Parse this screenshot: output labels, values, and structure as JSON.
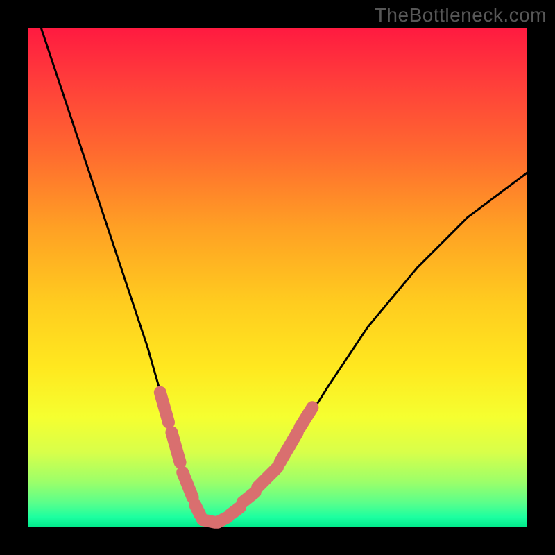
{
  "watermark": "TheBottleneck.com",
  "colors": {
    "frame": "#000000",
    "gradient_top": "#ff1a40",
    "gradient_bottom": "#00e88a",
    "curve": "#000000",
    "marker": "#d96f6f"
  },
  "chart_data": {
    "type": "line",
    "title": "",
    "xlabel": "",
    "ylabel": "",
    "xlim": [
      0,
      100
    ],
    "ylim": [
      0,
      100
    ],
    "grid": false,
    "legend": false,
    "series": [
      {
        "name": "bottleneck-curve",
        "x": [
          0,
          4,
          8,
          12,
          16,
          20,
          24,
          28,
          30,
          32,
          33,
          34,
          35,
          36,
          37,
          38,
          40,
          42,
          45,
          50,
          55,
          60,
          68,
          78,
          88,
          100
        ],
        "y": [
          108,
          96,
          84,
          72,
          60,
          48,
          36,
          22,
          15,
          9,
          6,
          4,
          2,
          1,
          1,
          1,
          2,
          3,
          6,
          12,
          20,
          28,
          40,
          52,
          62,
          71
        ]
      }
    ],
    "markers": {
      "name": "segment-highlights",
      "color": "#d96f6f",
      "segments": [
        {
          "x": [
            26.5,
            28.2
          ],
          "y": [
            27,
            21
          ]
        },
        {
          "x": [
            28.8,
            30.5
          ],
          "y": [
            19,
            13
          ]
        },
        {
          "x": [
            31.0,
            33.0
          ],
          "y": [
            11,
            6
          ]
        },
        {
          "x": [
            33.5,
            34.5
          ],
          "y": [
            4.5,
            2.5
          ]
        },
        {
          "x": [
            35.0,
            37.5
          ],
          "y": [
            1.5,
            1
          ]
        },
        {
          "x": [
            38.0,
            40.0
          ],
          "y": [
            1,
            2
          ]
        },
        {
          "x": [
            40.5,
            42.5
          ],
          "y": [
            2.5,
            4
          ]
        },
        {
          "x": [
            43.0,
            45.5
          ],
          "y": [
            5,
            7
          ]
        },
        {
          "x": [
            46.0,
            50.0
          ],
          "y": [
            8,
            12
          ]
        },
        {
          "x": [
            50.5,
            54.0
          ],
          "y": [
            13,
            19
          ]
        },
        {
          "x": [
            54.5,
            57.0
          ],
          "y": [
            20,
            24
          ]
        }
      ]
    }
  }
}
